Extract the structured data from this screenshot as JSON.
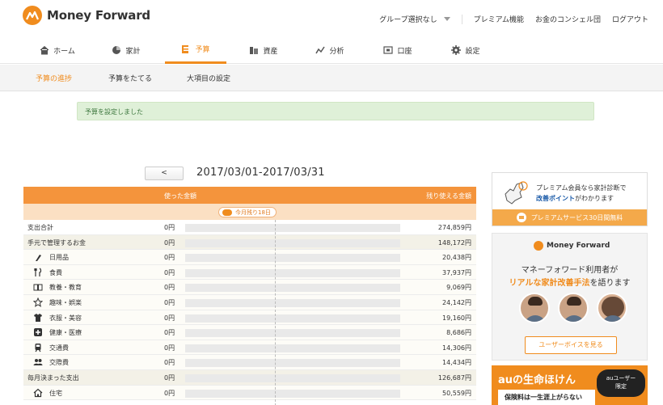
{
  "header": {
    "logo_text": "Money Forward",
    "nav": [
      "グループ選択なし",
      "プレミアム機能",
      "お金のコンシェル団",
      "ログアウト"
    ]
  },
  "tabs": [
    {
      "label": "ホーム",
      "icon": "home-icon"
    },
    {
      "label": "家計",
      "icon": "pie-chart-icon"
    },
    {
      "label": "予算",
      "icon": "budget-icon",
      "active": true
    },
    {
      "label": "資産",
      "icon": "asset-icon"
    },
    {
      "label": "分析",
      "icon": "analysis-icon"
    },
    {
      "label": "口座",
      "icon": "account-icon"
    },
    {
      "label": "設定",
      "icon": "gear-icon"
    }
  ],
  "subtabs": [
    "予算の進捗",
    "予算をたてる",
    "大項目の設定"
  ],
  "flash": "予算を設定しました",
  "period": {
    "prev_label": "<",
    "range": "2017/03/01-2017/03/31"
  },
  "table": {
    "col_used": "使った金額",
    "col_remaining": "残り使える金額",
    "today_badge": "今月残り18日",
    "rows": [
      {
        "label": "支出合計",
        "used": "0円",
        "remaining": "274,859円",
        "kind": "total"
      },
      {
        "label": "手元で管理するお金",
        "used": "0円",
        "remaining": "148,172円",
        "kind": "group"
      },
      {
        "label": "日用品",
        "used": "0円",
        "remaining": "20,438円",
        "kind": "sub",
        "icon": "daily-goods-icon"
      },
      {
        "label": "食費",
        "used": "0円",
        "remaining": "37,937円",
        "kind": "sub",
        "icon": "fork-knife-icon"
      },
      {
        "label": "教養・教育",
        "used": "0円",
        "remaining": "9,069円",
        "kind": "sub",
        "icon": "book-icon"
      },
      {
        "label": "趣味・娯楽",
        "used": "0円",
        "remaining": "24,142円",
        "kind": "sub",
        "icon": "star-icon"
      },
      {
        "label": "衣服・美容",
        "used": "0円",
        "remaining": "19,160円",
        "kind": "sub",
        "icon": "shirt-icon"
      },
      {
        "label": "健康・医療",
        "used": "0円",
        "remaining": "8,686円",
        "kind": "sub",
        "icon": "medical-cross-icon"
      },
      {
        "label": "交通費",
        "used": "0円",
        "remaining": "14,306円",
        "kind": "sub",
        "icon": "train-icon"
      },
      {
        "label": "交際費",
        "used": "0円",
        "remaining": "14,434円",
        "kind": "sub",
        "icon": "people-icon"
      },
      {
        "label": "毎月決まった支出",
        "used": "0円",
        "remaining": "126,687円",
        "kind": "group"
      },
      {
        "label": "住宅",
        "used": "0円",
        "remaining": "50,559円",
        "kind": "sub",
        "icon": "house-icon"
      }
    ]
  },
  "sidebar": {
    "ad1_line1": "プレミアム会員なら家計診断で",
    "ad1_line2_hl": "改善ポイント",
    "ad1_line2_rest": "がわかります",
    "ad1_footer": "プレミアムサービス30日間無料",
    "ad2_logo": "Money Forward",
    "ad2_line1": "マネーフォワード利用者が",
    "ad2_line2_hl": "リアルな家計改善手法",
    "ad2_line2_rest": "を語ります",
    "ad2_button": "ユーザーボイスを見る",
    "ad3_brand": "auの生命ほけん",
    "ad3_badge_line1": "auユーザー",
    "ad3_badge_line2": "限定",
    "ad3_sub": "保険料は一生涯上がらない"
  },
  "colors": {
    "accent": "#f08c1e",
    "flash_bg": "#dff0d8",
    "flash_text": "#3c763d"
  }
}
